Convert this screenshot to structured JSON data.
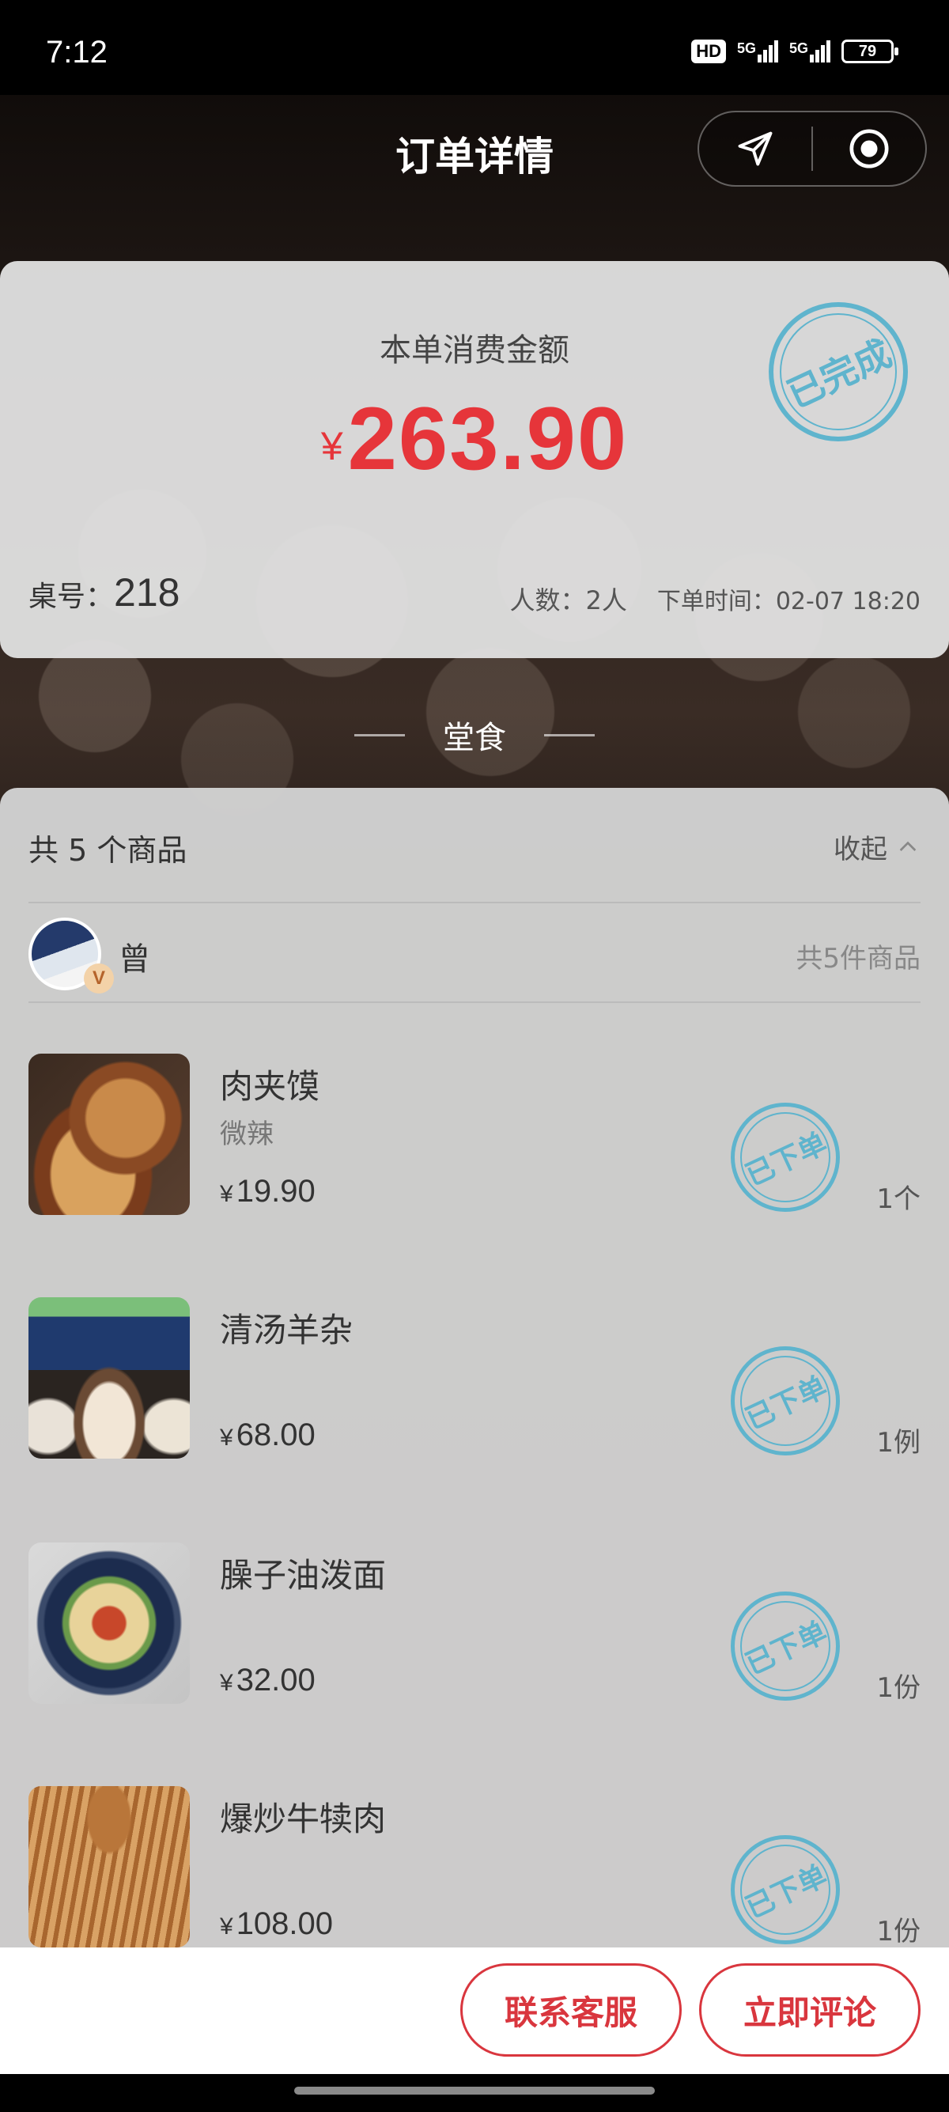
{
  "status_bar": {
    "time": "7:12",
    "hd_badge": "HD",
    "network_1": "5G",
    "network_2": "5G",
    "battery": "79"
  },
  "nav": {
    "title": "订单详情",
    "location_icon": "location-arrow-icon",
    "record_icon": "record-target-icon"
  },
  "summary": {
    "label": "本单消费金额",
    "currency": "¥",
    "amount": "263.90",
    "status_stamp": "已完成",
    "table_label": "桌号：",
    "table_number": "218",
    "people": "人数：2人",
    "order_time": "下单时间：02-07 18:20"
  },
  "section": {
    "title": "堂食"
  },
  "items_card": {
    "count_text": "共 5 个商品",
    "collapse_label": "收起",
    "user_name": "曾",
    "vip_badge": "V",
    "user_total": "共5件商品",
    "items": [
      {
        "name": "肉夹馍",
        "spec": "微辣",
        "currency": "¥",
        "price": "19.90",
        "qty": "1个",
        "stamp": "已下单"
      },
      {
        "name": "清汤羊杂",
        "spec": "",
        "currency": "¥",
        "price": "68.00",
        "qty": "1例",
        "stamp": "已下单"
      },
      {
        "name": "臊子油泼面",
        "spec": "",
        "currency": "¥",
        "price": "32.00",
        "qty": "1份",
        "stamp": "已下单"
      },
      {
        "name": "爆炒牛犊肉",
        "spec": "",
        "currency": "¥",
        "price": "108.00",
        "qty": "1份",
        "stamp": "已下单"
      }
    ]
  },
  "bottom_bar": {
    "service_button": "联系客服",
    "review_button": "立即评论"
  },
  "colors": {
    "accent_red": "#d9363e",
    "amount_red": "#e6353a",
    "stamp_blue": "#5fb4cd"
  }
}
